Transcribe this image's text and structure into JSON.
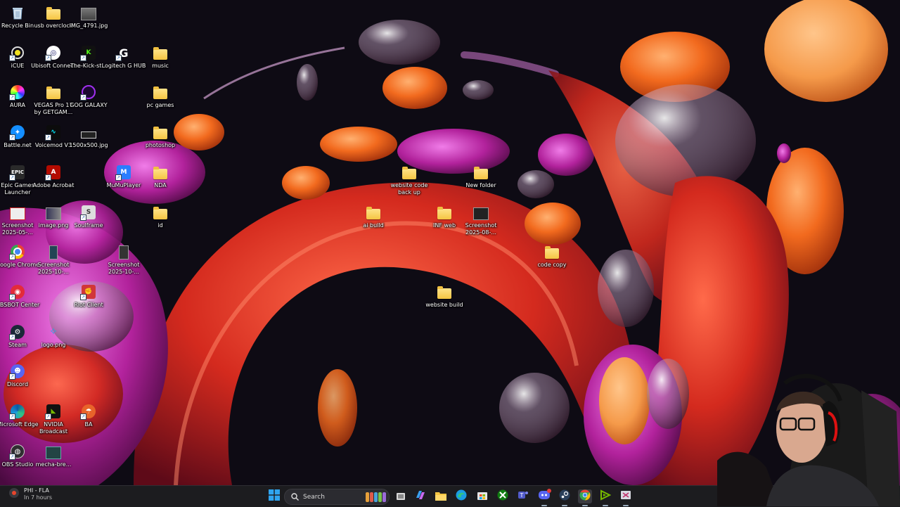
{
  "desktop": {
    "icons": [
      {
        "label": "Recycle Bin",
        "icon": "recycle-bin-icon"
      },
      {
        "label": "usb overclock",
        "icon": "folder-icon"
      },
      {
        "label": "IMG_4791.jpg",
        "icon": "image-file-icon"
      },
      {
        "label": "iCUE",
        "icon": "icue-icon"
      },
      {
        "label": "Ubisoft Connect",
        "icon": "ubisoft-connect-icon"
      },
      {
        "label": "The-Kick-st...",
        "icon": "kick-icon"
      },
      {
        "label": "Logitech G HUB",
        "icon": "logitech-g-hub-icon"
      },
      {
        "label": "music",
        "icon": "folder-icon"
      },
      {
        "label": "AURA",
        "icon": "aura-icon"
      },
      {
        "label": "VEGAS Pro 17 by GETGAM...",
        "icon": "folder-icon"
      },
      {
        "label": "GOG GALAXY",
        "icon": "gog-galaxy-icon"
      },
      {
        "label": "pc games",
        "icon": "folder-icon"
      },
      {
        "label": "Battle.net",
        "icon": "battle-net-icon"
      },
      {
        "label": "Voicemod V3",
        "icon": "voicemod-icon"
      },
      {
        "label": "1500x500.jpg",
        "icon": "image-file-icon"
      },
      {
        "label": "photoshop",
        "icon": "folder-icon"
      },
      {
        "label": "Epic Games Launcher",
        "icon": "epic-games-icon"
      },
      {
        "label": "Adobe Acrobat",
        "icon": "adobe-acrobat-icon"
      },
      {
        "label": "MuMuPlayer",
        "icon": "mumuplayer-icon"
      },
      {
        "label": "NDA",
        "icon": "folder-icon"
      },
      {
        "label": "website code back up",
        "icon": "folder-icon"
      },
      {
        "label": "New folder",
        "icon": "folder-icon"
      },
      {
        "label": "Screenshot 2025-05-...",
        "icon": "image-file-icon"
      },
      {
        "label": "image.png",
        "icon": "image-file-icon"
      },
      {
        "label": "Soulframe",
        "icon": "soulframe-icon"
      },
      {
        "label": "id",
        "icon": "folder-icon"
      },
      {
        "label": "ai build",
        "icon": "folder-icon"
      },
      {
        "label": "INF web",
        "icon": "folder-icon"
      },
      {
        "label": "Screenshot 2025-08-...",
        "icon": "image-file-icon"
      },
      {
        "label": "Google Chrome",
        "icon": "chrome-icon"
      },
      {
        "label": "Screenshot 2025-10-...",
        "icon": "image-file-icon"
      },
      {
        "label": "Screenshot 2025-10-...",
        "icon": "image-file-icon"
      },
      {
        "label": "code copy",
        "icon": "folder-icon"
      },
      {
        "label": "OBSBOT Center",
        "icon": "obsbot-icon"
      },
      {
        "label": "Riot Client",
        "icon": "riot-client-icon"
      },
      {
        "label": "website build",
        "icon": "folder-icon"
      },
      {
        "label": "Steam",
        "icon": "steam-icon"
      },
      {
        "label": "logo.png",
        "icon": "image-file-icon"
      },
      {
        "label": "Discord",
        "icon": "discord-icon"
      },
      {
        "label": "Microsoft Edge",
        "icon": "edge-icon"
      },
      {
        "label": "NVIDIA Broadcast",
        "icon": "nvidia-broadcast-icon"
      },
      {
        "label": "BA",
        "icon": "ba-icon"
      },
      {
        "label": "OBS Studio",
        "icon": "obs-studio-icon"
      },
      {
        "label": "mecha-bre...",
        "icon": "image-file-icon"
      }
    ]
  },
  "taskbar": {
    "weather": {
      "text": "PHI - FLA",
      "subtext": "In 7 hours"
    },
    "search": {
      "placeholder": "Search"
    },
    "apps": [
      {
        "name": "start",
        "icon": "windows-start-icon"
      },
      {
        "name": "task-view",
        "icon": "task-view-icon"
      },
      {
        "name": "copilot",
        "icon": "copilot-icon"
      },
      {
        "name": "file-explorer",
        "icon": "file-explorer-icon"
      },
      {
        "name": "edge",
        "icon": "edge-icon"
      },
      {
        "name": "microsoft-store",
        "icon": "store-icon"
      },
      {
        "name": "xbox",
        "icon": "xbox-icon"
      },
      {
        "name": "teams",
        "icon": "teams-icon"
      },
      {
        "name": "discord",
        "icon": "discord-icon"
      },
      {
        "name": "steam",
        "icon": "steam-icon"
      },
      {
        "name": "chrome",
        "icon": "chrome-icon"
      },
      {
        "name": "nvidia-broadcast",
        "icon": "nvidia-broadcast-icon"
      },
      {
        "name": "snipping-tool",
        "icon": "snipping-tool-icon"
      }
    ]
  },
  "colors": {
    "taskbar_bg": "#1c1c1f",
    "folder": "#f5c542",
    "accent": "#e8452c"
  }
}
